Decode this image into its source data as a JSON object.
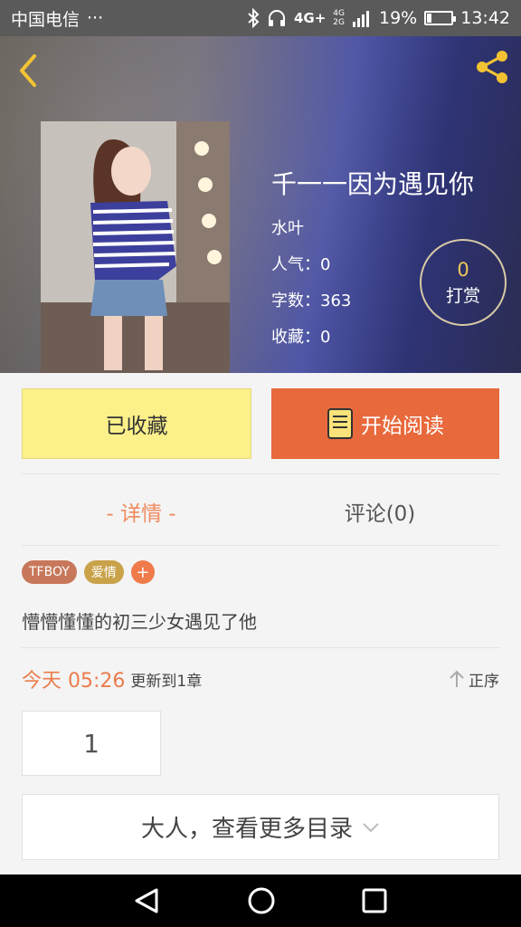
{
  "status_bar": {
    "carrier": "中国电信",
    "dots": "···",
    "network": "4G+",
    "network2": "4G",
    "network3": "2G",
    "battery_percent": "19%",
    "time": "13:42"
  },
  "book": {
    "title": "千一一因为遇见你",
    "author": "水叶",
    "popularity_label": "人气：",
    "popularity": "0",
    "words_label": "字数：",
    "words": "363",
    "favorites_label": "收藏：",
    "favorites": "0"
  },
  "tip": {
    "count": "0",
    "label": "打赏"
  },
  "actions": {
    "collected_label": "已收藏",
    "read_label": "开始阅读"
  },
  "tabs": {
    "detail": "- 详情 -",
    "comments": "评论(0)"
  },
  "tags": [
    {
      "label": "TFBOY",
      "color": "#c8775a"
    },
    {
      "label": "爱情",
      "color": "#c9a24a"
    }
  ],
  "tag_add": "+",
  "description": "懵懵懂懂的初三少女遇见了他",
  "update": {
    "time": "今天 05:26",
    "text": "更新到1章",
    "sort_label": "正序"
  },
  "chapter": {
    "number": "1"
  },
  "more_catalog": "大人，查看更多目录",
  "colors": {
    "accent": "#e8693c",
    "collected_bg": "#fbf08a"
  }
}
